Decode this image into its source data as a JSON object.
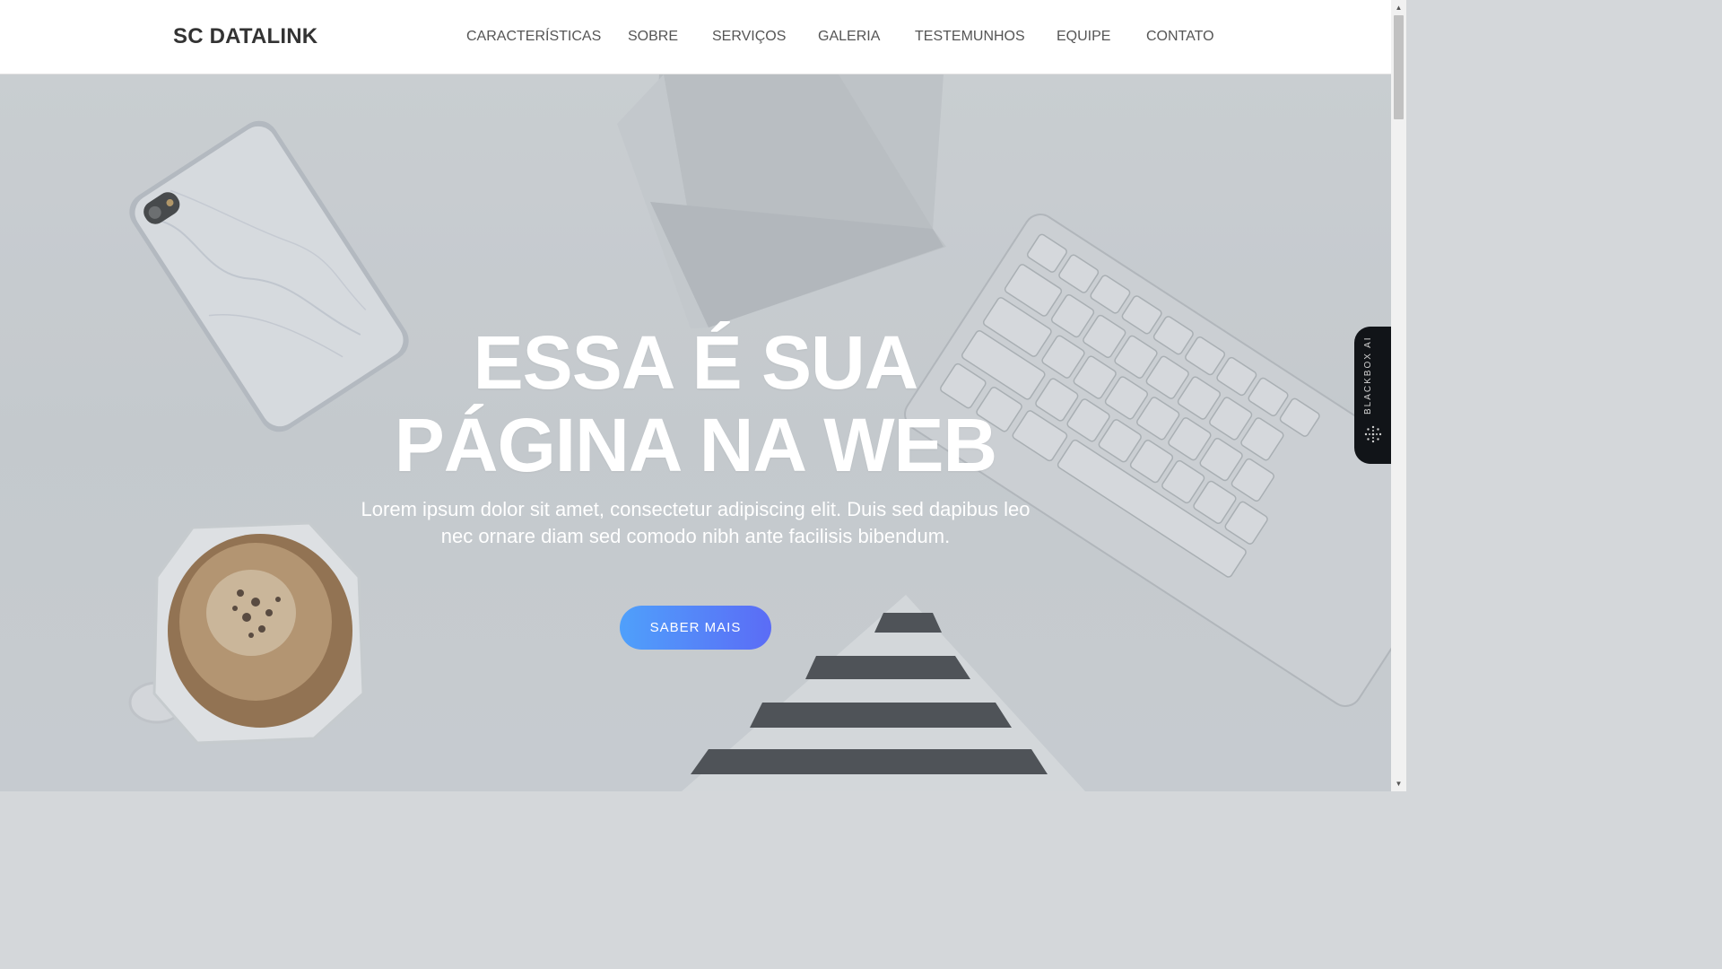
{
  "navbar": {
    "brand": "SC DATALINK",
    "links": [
      {
        "label": "CARACTERÍSTICAS"
      },
      {
        "label": "SOBRE"
      },
      {
        "label": "SERVIÇOS"
      },
      {
        "label": "GALERIA"
      },
      {
        "label": "TESTEMUNHOS"
      },
      {
        "label": "EQUIPE"
      },
      {
        "label": "CONTATO"
      }
    ]
  },
  "hero": {
    "title_line1": "ESSA É SUA",
    "title_line2": "PÁGINA NA WEB",
    "subtitle": "Lorem ipsum dolor sit amet, consectetur adipiscing elit. Duis sed dapibus leo nec ornare diam sed comodo nibh ante facilisis bibendum.",
    "cta_label": "SABER MAIS"
  },
  "side_widget": {
    "label": "BLACKBOX AI",
    "icon": "dots-sparkle-icon"
  },
  "scrollbar": {
    "up_icon": "arrow-up-icon",
    "down_icon": "arrow-down-icon"
  },
  "colors": {
    "cta_gradient_start": "#4fa0fb",
    "cta_gradient_end": "#5b6cf6",
    "brand_text": "#333333",
    "nav_text": "#555555",
    "widget_bg": "#111418"
  }
}
